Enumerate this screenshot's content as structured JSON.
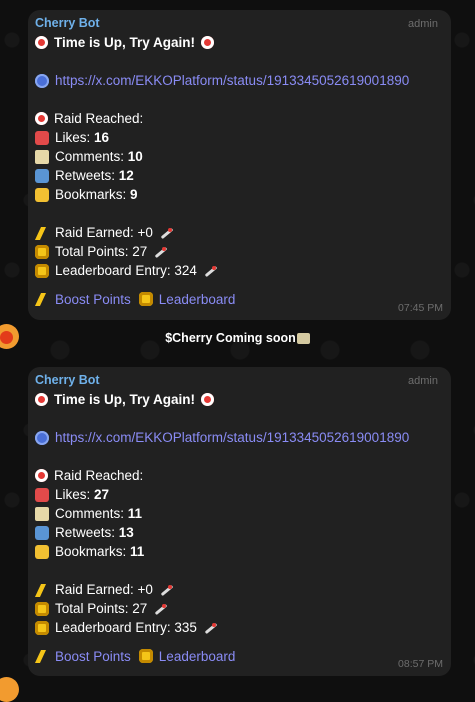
{
  "announcement": "$Cherry Coming soon",
  "messages": [
    {
      "sender": "Cherry Bot",
      "role": "admin",
      "title": "Time is Up, Try Again!",
      "link": "https://x.com/EKKOPlatform/status/1913345052619001890",
      "raid_reached": "Raid Reached:",
      "likes_label": "Likes:",
      "likes": "16",
      "comments_label": "Comments:",
      "comments": "10",
      "retweets_label": "Retweets:",
      "retweets": "12",
      "bookmarks_label": "Bookmarks:",
      "bookmarks": "9",
      "raid_earned": "Raid Earned: +0",
      "total_points": "Total Points: 27",
      "leaderboard_entry": "Leaderboard Entry: 324",
      "boost_label": "Boost Points",
      "leaderboard_label": "Leaderboard",
      "time": "07:45 PM"
    },
    {
      "sender": "Cherry Bot",
      "role": "admin",
      "title": "Time is Up, Try Again!",
      "link": "https://x.com/EKKOPlatform/status/1913345052619001890",
      "raid_reached": "Raid Reached:",
      "likes_label": "Likes:",
      "likes": "27",
      "comments_label": "Comments:",
      "comments": "11",
      "retweets_label": "Retweets:",
      "retweets": "13",
      "bookmarks_label": "Bookmarks:",
      "bookmarks": "11",
      "raid_earned": "Raid Earned: +0",
      "total_points": "Total Points: 27",
      "leaderboard_entry": "Leaderboard Entry: 335",
      "boost_label": "Boost Points",
      "leaderboard_label": "Leaderboard",
      "time": "08:57 PM"
    }
  ],
  "icons": {
    "alarm": "alarm-clock-icon",
    "globe": "globe-icon",
    "heart": "heart-icon",
    "comment": "comment-icon",
    "retweet": "retweet-icon",
    "star": "star-icon",
    "bolt": "lightning-icon",
    "medal": "medal-icon",
    "rocket": "rocket-icon"
  },
  "colors": {
    "sender": "#6fb1ea",
    "link": "#8a8cf5",
    "bubble": "#212121",
    "background": "#0f0f0f"
  }
}
